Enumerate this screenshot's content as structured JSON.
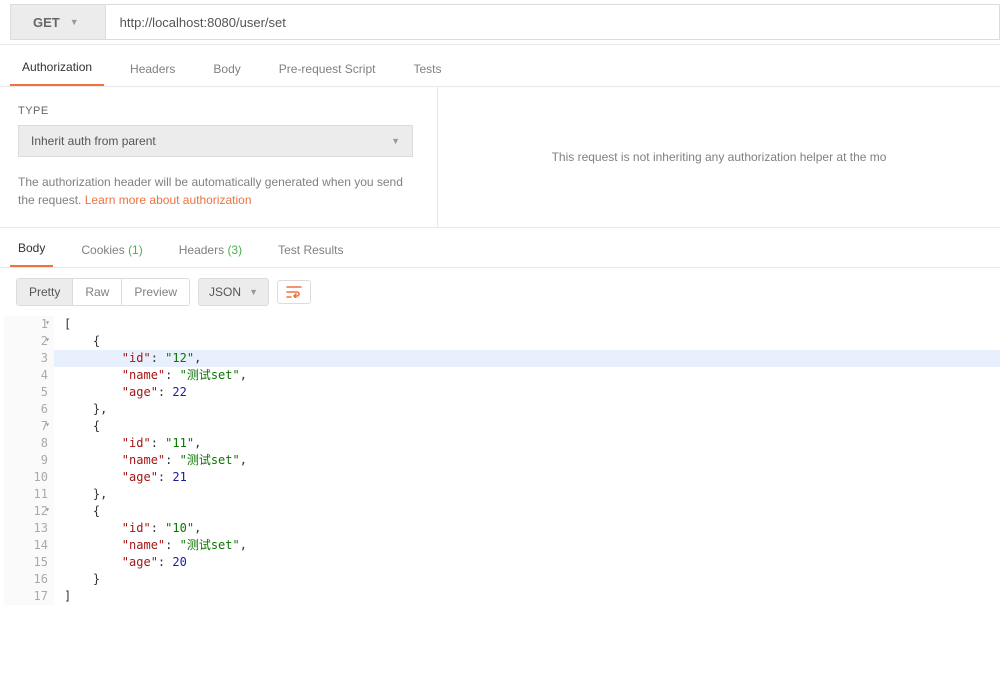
{
  "request": {
    "method": "GET",
    "url": "http://localhost:8080/user/set"
  },
  "reqTabs": {
    "authorization": "Authorization",
    "headers": "Headers",
    "body": "Body",
    "prerequest": "Pre-request Script",
    "tests": "Tests"
  },
  "auth": {
    "typeLabel": "TYPE",
    "typeValue": "Inherit auth from parent",
    "helpText": "The authorization header will be automatically generated when you send the request. ",
    "learnMore": "Learn more about authorization",
    "rightMessage": "This request is not inheriting any authorization helper at the mo"
  },
  "respTabs": {
    "body": "Body",
    "cookies": "Cookies",
    "cookiesCount": "(1)",
    "headers": "Headers",
    "headersCount": "(3)",
    "testResults": "Test Results"
  },
  "bodyToolbar": {
    "pretty": "Pretty",
    "raw": "Raw",
    "preview": "Preview",
    "format": "JSON"
  },
  "responseLines": [
    {
      "n": "1",
      "fold": true,
      "text": "["
    },
    {
      "n": "2",
      "fold": true,
      "text": "    {"
    },
    {
      "n": "3",
      "hl": true,
      "kv": {
        "indent": "        ",
        "key": "\"id\"",
        "sep": ": ",
        "val": "\"12\"",
        "tail": ",",
        "valType": "str"
      }
    },
    {
      "n": "4",
      "kv": {
        "indent": "        ",
        "key": "\"name\"",
        "sep": ": ",
        "val": "\"测试set\"",
        "tail": ",",
        "valType": "str"
      }
    },
    {
      "n": "5",
      "kv": {
        "indent": "        ",
        "key": "\"age\"",
        "sep": ": ",
        "val": "22",
        "tail": "",
        "valType": "num"
      }
    },
    {
      "n": "6",
      "text": "    },"
    },
    {
      "n": "7",
      "fold": true,
      "text": "    {"
    },
    {
      "n": "8",
      "kv": {
        "indent": "        ",
        "key": "\"id\"",
        "sep": ": ",
        "val": "\"11\"",
        "tail": ",",
        "valType": "str"
      }
    },
    {
      "n": "9",
      "kv": {
        "indent": "        ",
        "key": "\"name\"",
        "sep": ": ",
        "val": "\"测试set\"",
        "tail": ",",
        "valType": "str"
      }
    },
    {
      "n": "10",
      "kv": {
        "indent": "        ",
        "key": "\"age\"",
        "sep": ": ",
        "val": "21",
        "tail": "",
        "valType": "num"
      }
    },
    {
      "n": "11",
      "text": "    },"
    },
    {
      "n": "12",
      "fold": true,
      "text": "    {"
    },
    {
      "n": "13",
      "kv": {
        "indent": "        ",
        "key": "\"id\"",
        "sep": ": ",
        "val": "\"10\"",
        "tail": ",",
        "valType": "str"
      }
    },
    {
      "n": "14",
      "kv": {
        "indent": "        ",
        "key": "\"name\"",
        "sep": ": ",
        "val": "\"测试set\"",
        "tail": ",",
        "valType": "str"
      }
    },
    {
      "n": "15",
      "kv": {
        "indent": "        ",
        "key": "\"age\"",
        "sep": ": ",
        "val": "20",
        "tail": "",
        "valType": "num"
      }
    },
    {
      "n": "16",
      "text": "    }"
    },
    {
      "n": "17",
      "text": "]"
    }
  ]
}
